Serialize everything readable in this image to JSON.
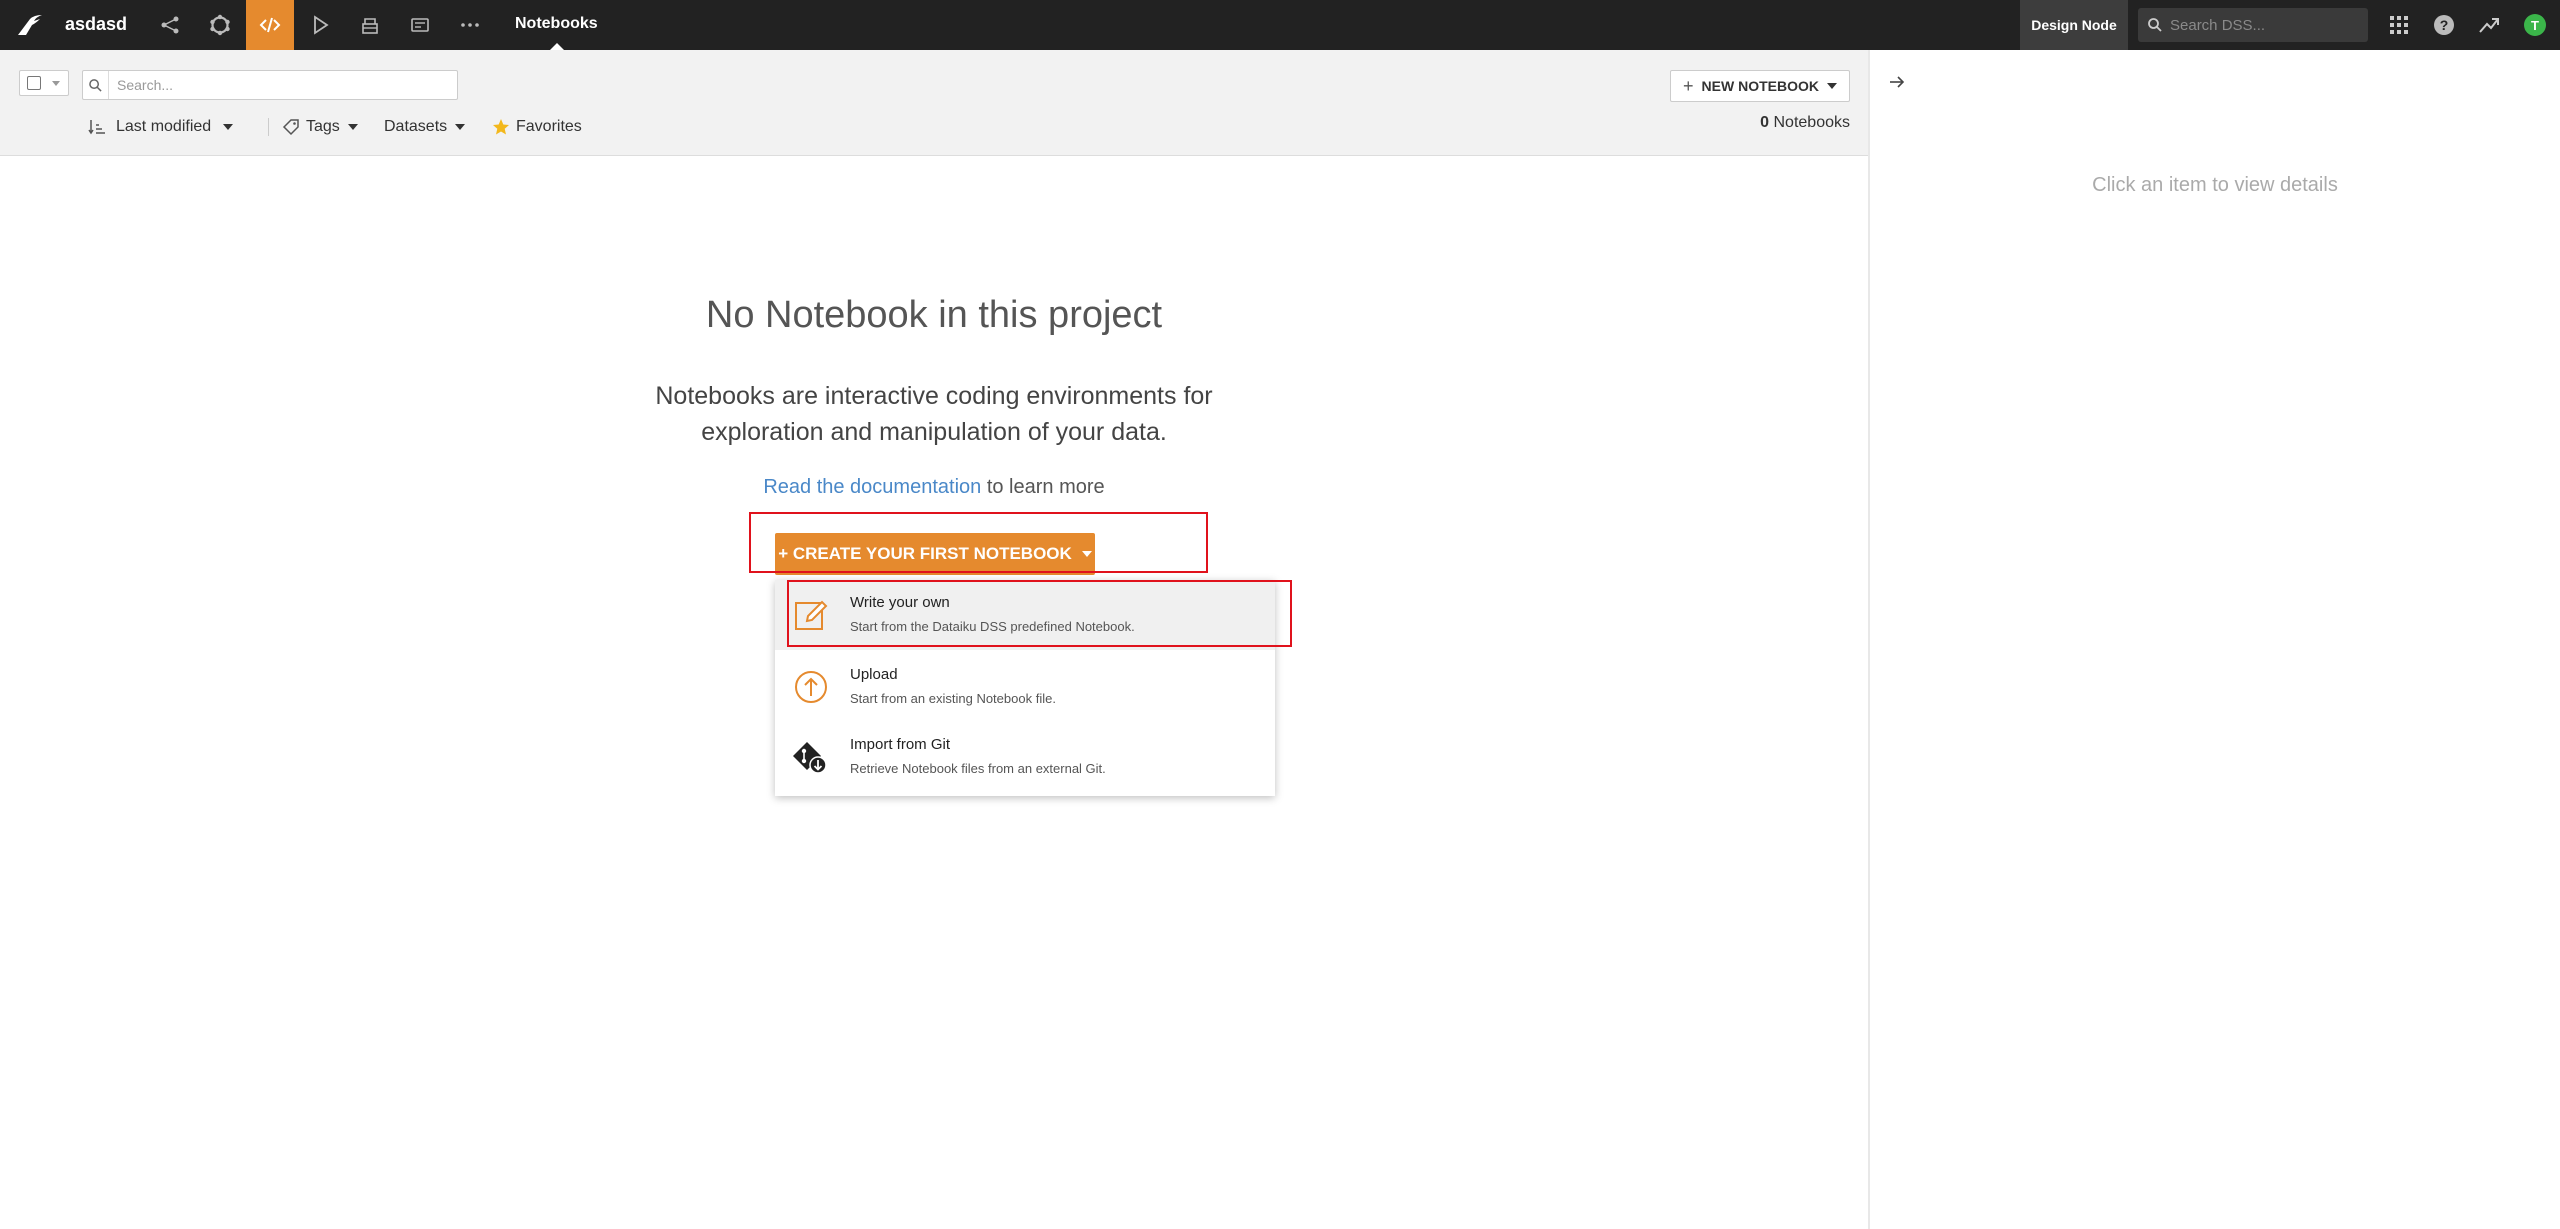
{
  "topbar": {
    "project_name": "asdasd",
    "current_section": "Notebooks",
    "node_label": "Design Node",
    "search_placeholder": "Search DSS...",
    "help_label": "?",
    "avatar_initial": "T"
  },
  "filterbar": {
    "search_placeholder": "Search...",
    "new_notebook_label": "NEW NOTEBOOK",
    "sort_label": "Last modified",
    "tags_label": "Tags",
    "datasets_label": "Datasets",
    "favorites_label": "Favorites",
    "count_value": "0",
    "count_label": "Notebooks"
  },
  "right_panel": {
    "hint": "Click an item to view details"
  },
  "empty_state": {
    "title": "No Notebook in this project",
    "description": "Notebooks are interactive coding environments for exploration and manipulation of your data.",
    "doc_link": "Read the documentation",
    "doc_suffix": " to learn more",
    "create_label": "+ CREATE YOUR FIRST NOTEBOOK"
  },
  "dropdown": {
    "items": [
      {
        "title": "Write your own",
        "subtitle": "Start from the Dataiku DSS predefined Notebook.",
        "icon": "edit-icon"
      },
      {
        "title": "Upload",
        "subtitle": "Start from an existing Notebook file.",
        "icon": "upload-icon"
      },
      {
        "title": "Import from Git",
        "subtitle": "Retrieve Notebook files from an external Git.",
        "icon": "git-icon"
      }
    ]
  },
  "colors": {
    "accent": "#e58a2e",
    "topbar": "#222222",
    "link": "#4a88c8",
    "highlight": "#e0121c"
  }
}
